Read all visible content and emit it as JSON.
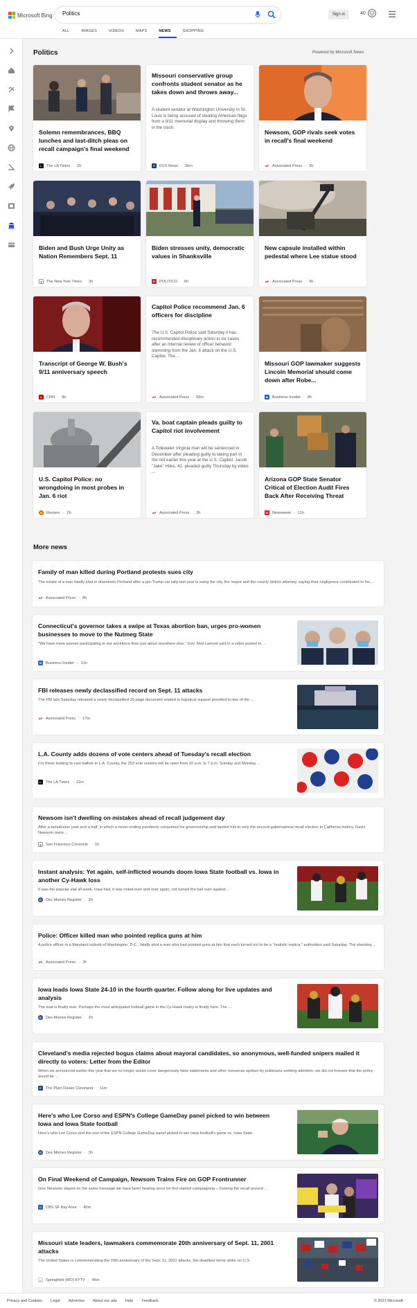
{
  "brand": {
    "logo_text": "Microsoft Bing"
  },
  "search": {
    "query": "Politics"
  },
  "header": {
    "sign_in": "Sign in",
    "points": "40"
  },
  "tabs": [
    "ALL",
    "IMAGES",
    "VIDEOS",
    "MAPS",
    "NEWS",
    "SHOPPING"
  ],
  "section": {
    "title": "Politics",
    "powered_by": "Powered by Microsoft News"
  },
  "top_cards": [
    {
      "headline": "Solemn remembrances, BBQ lunches and last-ditch pleas on recall campaign's final weekend",
      "source": "The LA Times",
      "time": "2h"
    },
    {
      "headline": "Missouri conservative group confronts student senator as he takes down and throws away...",
      "snippet": "A student senator at Washington University in St. Louis is being accused of stealing American flags from a 9/11 memorial display and throwing them in the trash.",
      "source": "FOX News",
      "time": "36m"
    },
    {
      "headline": "Newsom, GOP rivals seek votes in recall's final weekend",
      "source": "Associated Press",
      "time": "3h"
    },
    {
      "headline": "Biden and Bush Urge Unity as Nation Remembers Sept. 11",
      "source": "The New York Times",
      "time": "3h"
    },
    {
      "headline": "Biden stresses unity, democratic values in Shanksville",
      "source": "POLITICO",
      "time": "6h"
    },
    {
      "headline": "New capsule installed within pedestal where Lee statue stood",
      "source": "Associated Press",
      "time": "9h"
    },
    {
      "headline": "Transcript of George W. Bush's 9/11 anniversary speech",
      "source": "CNN",
      "time": "9h"
    },
    {
      "headline": "Capitol Police recommend Jan. 6 officers for discipline",
      "snippet": "The U.S. Capitol Police said Saturday it has recommended disciplinary action in six cases after an internal review of officer behavior stemming from the Jan. 6 attack on the U.S. Capitol. The ...",
      "source": "Associated Press",
      "time": "50m"
    },
    {
      "headline": "Missouri GOP lawmaker suggests Lincoln Memorial should come down after Robe...",
      "source": "Business Insider",
      "time": "9h"
    },
    {
      "headline": "U.S. Capitol Police: no wrongdoing in most probes in Jan. 6 riot",
      "source": "Reuters",
      "time": "2h"
    },
    {
      "headline": "Va. boat captain pleads guilty to Capitol riot involvement",
      "snippet": "A Tidewater Virginia man will be sentenced in December after pleading guilty to taking part in the riot earlier this year at the U.S. Capitol. Jacob \"Jake\" Hiles, 42, pleaded guilty Thursday by video ...",
      "source": "Associated Press",
      "time": "3h"
    },
    {
      "headline": "Arizona GOP State Senator Critical of Election Audit Fires Back After Receiving Threat",
      "source": "Newsweek",
      "time": "11h"
    }
  ],
  "more_news": {
    "title": "More news",
    "items": [
      {
        "headline": "Family of man killed during Portland protests sues city",
        "snippet": "The estate of a man fatally shot in downtown Portland after a pro-Trump car rally last year is suing the city, the mayor and the county district attorney, saying their negligence contributed to his ...",
        "source": "Associated Press",
        "time": "8h"
      },
      {
        "headline": "Connecticut's governor takes a swipe at Texas abortion ban, urges pro-women businesses to move to the Nutmeg State",
        "snippet": "\"We have more women participating in our workforce than just about anywhere else,\" Gov. Ned Lamont said in a video posted to ...",
        "source": "Business Insider",
        "time": "11h"
      },
      {
        "headline": "FBI releases newly declassified record on Sept. 11 attacks",
        "snippet": "The FBI late Saturday released a newly declassified 16-page document related to logistical support provided to two of the ...",
        "source": "Associated Press",
        "time": "17m"
      },
      {
        "headline": "L.A. County adds dozens of vote centers ahead of Tuesday's recall election",
        "snippet": "For those looking to cast ballots in L.A. County, the 253 vote centers will be open from 10 a.m. to 7 p.m. Sunday and Monday, ...",
        "source": "The LA Times",
        "time": "31m"
      },
      {
        "headline": "Newsom isn't dwelling on mistakes ahead of recall judgement day",
        "snippet": "After a tumultuous year and a half, in which a never-ending pandemic consumed his governorship and landed him in only the second gubernatorial recall election in California history, Gavin Newsom owns ...",
        "source": "San Francisco Chronicle",
        "time": "1h"
      },
      {
        "headline": "Instant analysis: Yet again, self-inflicted wounds doom Iowa State football vs. Iowa in another Cy-Hawk loss",
        "snippet": "It was the popular stat all week. Iowa had, it was noted over and over again, not turned the ball over against ...",
        "source": "Des Moines Register",
        "time": "2h"
      },
      {
        "headline": "Police: Officer killed man who pointed replica guns at him",
        "snippet": "A police officer in a Maryland suburb of Washington, D.C., fatally shot a man who had pointed guns at him that each turned out to be a \"realistic replica,\" authorities said Saturday. The shooting ...",
        "source": "Associated Press",
        "time": "2h"
      },
      {
        "headline": "Iowa leads Iowa State 24-10 in the fourth quarter. Follow along for live updates and analysis",
        "snippet": "The wait is finally over.  Perhaps the most anticipated football game in the Cy-Hawk rivalry is finally here. The ...",
        "source": "Des Moines Register",
        "time": "2h"
      },
      {
        "headline": "Cleveland's media rejected bogus claims about mayoral candidates, so anonymous, well-funded snipers mailed it directly to voters: Letter from the Editor",
        "snippet": "When we announced earlier this year that we no longer would cover dangerously false statements and other nonsense spoken by politicians seeking attention, we did not foresee that the policy would be ...",
        "source": "The Plain Dealer Cleveland",
        "time": "11m"
      },
      {
        "headline": "Here's who Lee Corso and ESPN's College GameDay panel picked to win between Iowa and Iowa State football",
        "snippet": "Here's who Lee Corso and the rest of the ESPN College GameDay panel picked to win Iowa football's game vs. Iowa State.",
        "source": "Des Moines Register",
        "time": "3h"
      },
      {
        "headline": "On Final Weekend of Campaign, Newsom Trains Fire on GOP Frontrunner",
        "snippet": "Gov. Newsom stayed on the same message we have been hearing since he first started campaigning -- framing the recall around ...",
        "source": "CBS SF Bay Area",
        "time": "40m"
      },
      {
        "headline": "Missouri state leaders, lawmakers commemorate 20th anniversary of Sept. 11, 2001 attacks",
        "snippet": "The United States is commemorating the 20th anniversary of the Sept. 11, 2001 attacks, the deadliest terror strike on U.S.",
        "source": "Springfield (MO) KYTV",
        "time": "46m"
      }
    ]
  },
  "footer": {
    "links": [
      "Privacy and Cookies",
      "Legal",
      "Advertise",
      "About our ads",
      "Help",
      "Feedback"
    ],
    "copyright": "© 2021 Microsoft"
  }
}
